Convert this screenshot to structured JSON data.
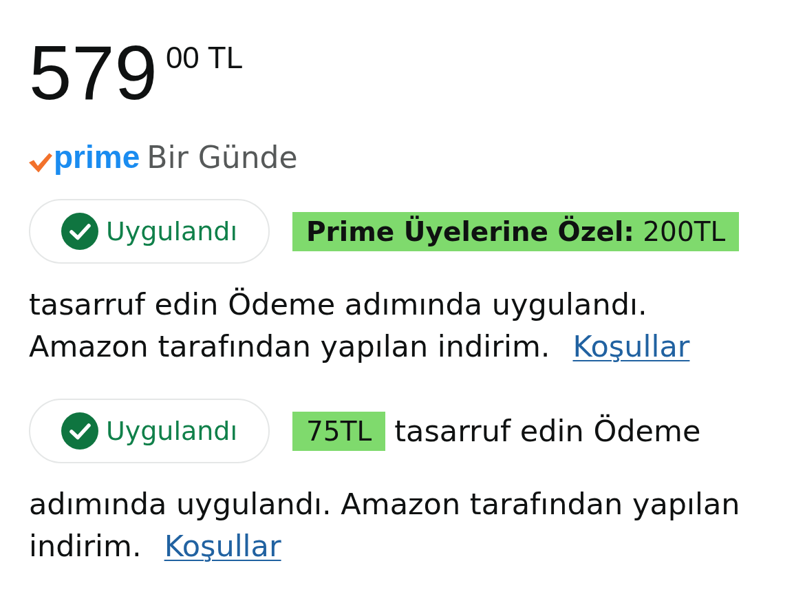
{
  "price": {
    "whole": "579",
    "fraction": "00",
    "currency": "TL"
  },
  "delivery": {
    "label": "prime",
    "text": "Bir Günde"
  },
  "coupons": [
    {
      "status": "Uygulandı",
      "applied": true,
      "highlight": "**Prime Üyelerine Özel:** 200TL",
      "text": "tasarruf edin Ödeme adımında uygulandı. Amazon tarafından yapılan indirim.",
      "link": "Koşullar"
    },
    {
      "status": "Uygulandı",
      "applied": true,
      "highlight": "75TL",
      "row_text": "tasarruf edin Ödeme",
      "text": "adımında uygulandı. Amazon tarafından yapılan indirim.",
      "link": "Koşullar"
    }
  ]
}
